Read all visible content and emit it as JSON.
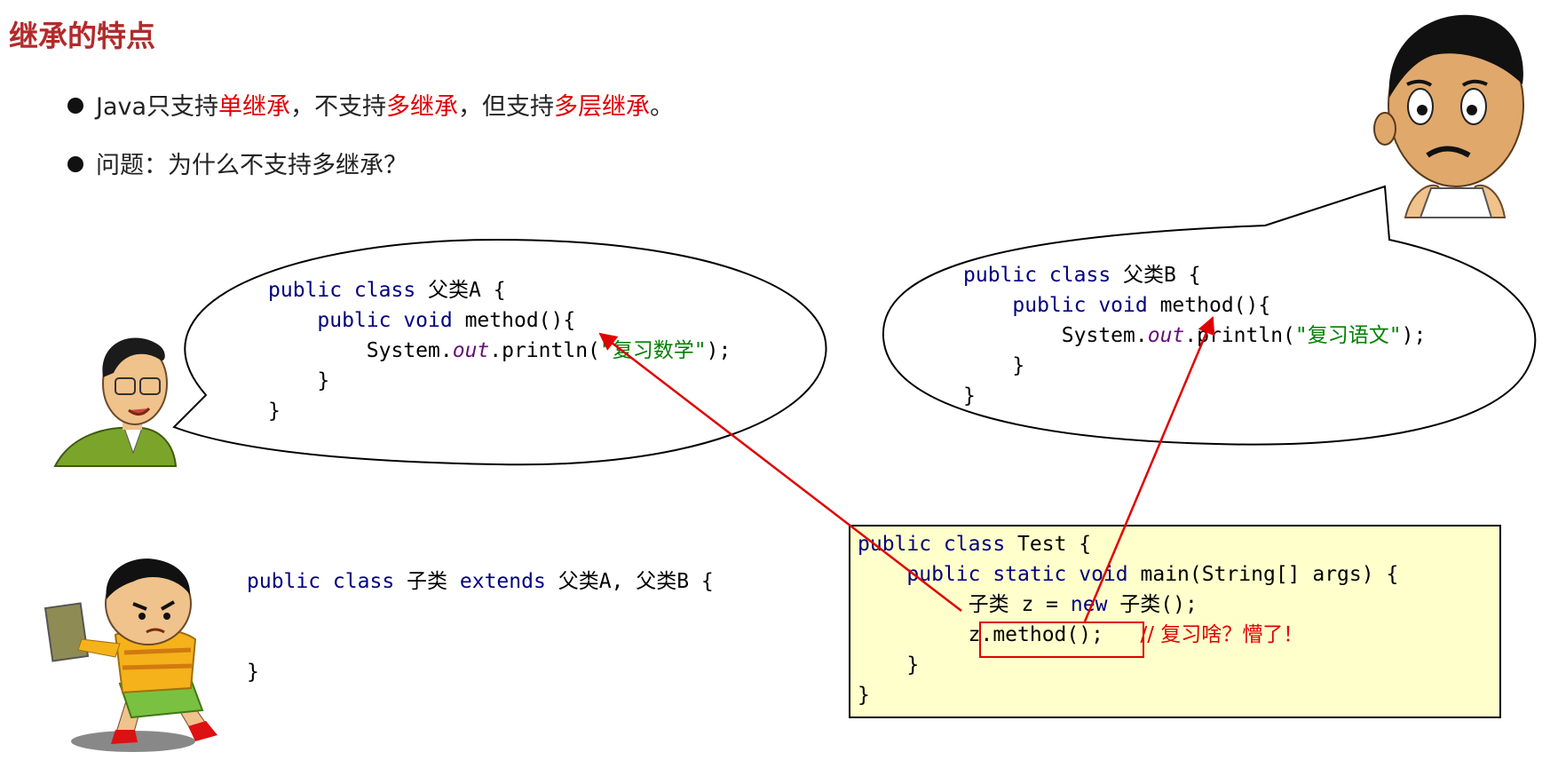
{
  "slide": {
    "title": "继承的特点",
    "bullet1": {
      "t1": "Java只支持",
      "h1": "单继承",
      "t2": "，不支持",
      "h2": "多继承",
      "t3": "，但支持",
      "h3": "多层继承",
      "t4": "。"
    },
    "bullet2": "问题：为什么不支持多继承？"
  },
  "code_a": {
    "kw1": "public class",
    "name": "父类A {",
    "kw2": "public void",
    "method": "method(){",
    "sys": "System.",
    "out": "out",
    "println": ".println(",
    "str": "\"复习数学\"",
    "end": ");",
    "close1": "}",
    "close2": "}"
  },
  "code_b": {
    "kw1": "public class",
    "name": "父类B {",
    "kw2": "public void",
    "method": "method(){",
    "sys": "System.",
    "out": "out",
    "println": ".println(",
    "str": "\"复习语文\"",
    "end": ");",
    "close1": "}",
    "close2": "}"
  },
  "code_child": {
    "kw1": "public class",
    "name": "子类",
    "kw2": "extends",
    "parents": "父类A, 父类B {",
    "close": "}"
  },
  "code_test": {
    "kw1": "public class",
    "name": "Test {",
    "kw2": "public static void",
    "main": "main(String[] args) {",
    "decl1": "子类 z = ",
    "kw3": "new",
    "decl2": " 子类();",
    "call": "z.method();",
    "comment": "// 复习啥？懵了！",
    "close1": "}",
    "close2": "}"
  },
  "colors": {
    "title": "#b32a2a",
    "highlight": "#e00000",
    "keyword": "#000080",
    "string": "#008000",
    "field": "#660e7a",
    "test_bg": "#ffffcc",
    "arrow": "#e00000"
  },
  "icons": [
    "teacher-cartoon-icon",
    "confused-boy-cartoon-icon",
    "angry-kid-cartoon-icon"
  ]
}
